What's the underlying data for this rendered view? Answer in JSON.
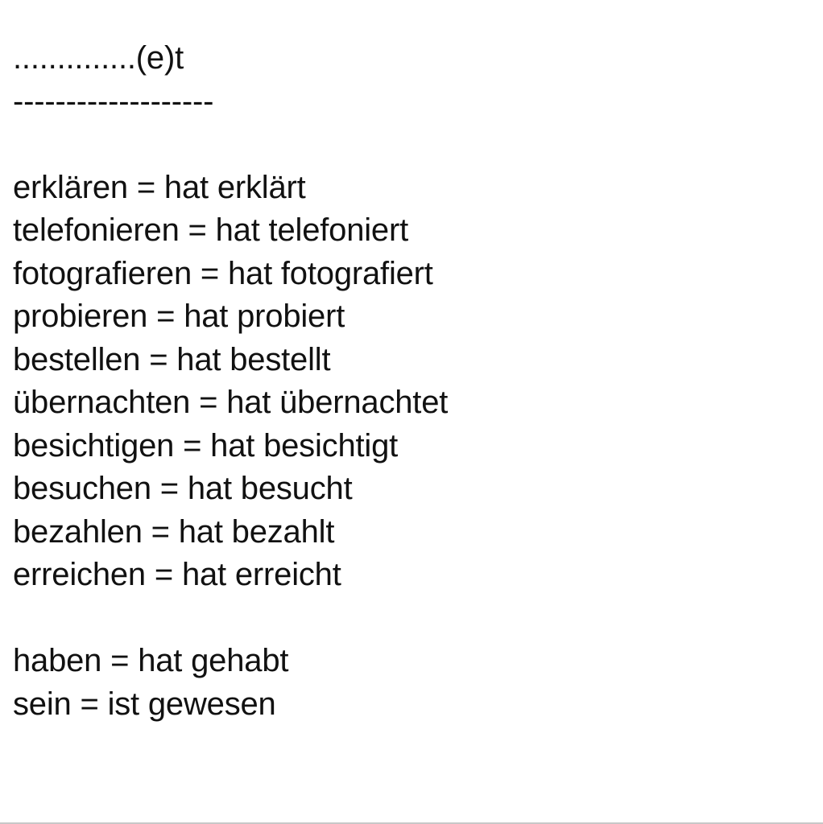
{
  "note": {
    "header": "..............(e)t",
    "separator": "-------------------",
    "verbs": [
      "erklären = hat erklärt",
      "telefonieren = hat telefoniert",
      "fotografieren = hat fotografiert",
      "probieren = hat probiert",
      "bestellen = hat bestellt",
      "übernachten = hat übernachtet",
      "besichtigen = hat besichtigt",
      "besuchen = hat besucht",
      "bezahlen = hat bezahlt",
      "erreichen = hat erreicht"
    ],
    "irregular": [
      "haben = hat gehabt",
      "sein = ist gewesen"
    ]
  }
}
